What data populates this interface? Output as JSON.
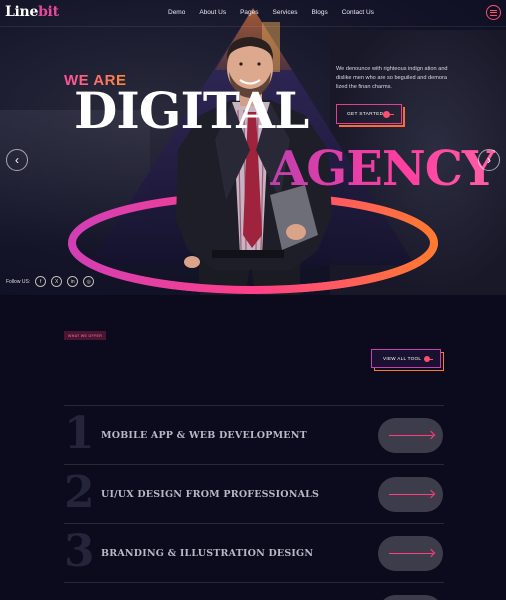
{
  "header": {
    "logo_part1": "Line",
    "logo_part2": "bit",
    "nav": [
      {
        "label": "Demo"
      },
      {
        "label": "About Us"
      },
      {
        "label": "Pages"
      },
      {
        "label": "Services"
      },
      {
        "label": "Blogs"
      },
      {
        "label": "Contact Us"
      }
    ],
    "menu_icon": "hamburger-icon"
  },
  "hero": {
    "we_are": "WE ARE",
    "digital": "DIGITAL",
    "agency": "AGENCY",
    "description": "We denounce with righteous indign ation and dislike men who are so beguiled and demora lized the finan charms.",
    "cta_label": "GET STARTED",
    "follow_label": "Follow US:",
    "socials": [
      {
        "icon": "facebook-icon",
        "glyph": "f"
      },
      {
        "icon": "x-icon",
        "glyph": "X"
      },
      {
        "icon": "linkedin-icon",
        "glyph": "in"
      },
      {
        "icon": "instagram-icon",
        "glyph": "◎"
      }
    ],
    "prev_icon": "chevron-left-icon",
    "next_icon": "chevron-right-icon"
  },
  "services": {
    "badge": "WHAT WE OFFER",
    "heading": "",
    "view_all_label": "VIEW ALL TOOL",
    "items": [
      {
        "num": "1",
        "title": "MOBILE APP & WEB DEVELOPMENT"
      },
      {
        "num": "2",
        "title": "UI/UX DESIGN FROM PROFESSIONALS"
      },
      {
        "num": "3",
        "title": "BRANDING & ILLUSTRATION DESIGN"
      }
    ]
  },
  "colors": {
    "background": "#0b0b1d",
    "accent_pink": "#e8479c",
    "accent_orange": "#ff7a30"
  }
}
